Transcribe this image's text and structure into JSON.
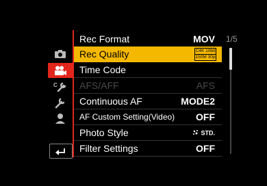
{
  "menu": {
    "items": [
      {
        "label": "Rec Format",
        "value": "MOV",
        "selected": false,
        "disabled": false
      },
      {
        "label": "Rec Quality",
        "value_badge_top": "C4K 10bit",
        "value_badge_bottom": "150M 30p",
        "selected": true,
        "disabled": false
      },
      {
        "label": "Time Code",
        "value": "",
        "selected": false,
        "disabled": false
      },
      {
        "label": "AFS/AFF",
        "value": "AFS",
        "selected": false,
        "disabled": true
      },
      {
        "label": "Continuous AF",
        "value": "MODE2",
        "selected": false,
        "disabled": false
      },
      {
        "label": "AF Custom Setting(Video)",
        "value": "OFF",
        "selected": false,
        "disabled": false
      },
      {
        "label": "Photo Style",
        "value": "STD.",
        "selected": false,
        "disabled": false
      },
      {
        "label": "Filter Settings",
        "value": "OFF",
        "selected": false,
        "disabled": false
      }
    ]
  },
  "page_indicator": "1/5",
  "sidebar": {
    "tabs": [
      {
        "name": "camera-icon",
        "active": false
      },
      {
        "name": "video-camera-icon",
        "active": true
      },
      {
        "name": "custom-wrench-icon",
        "active": false
      },
      {
        "name": "setup-wrench-icon",
        "active": false
      },
      {
        "name": "my-menu-person-icon",
        "active": false
      }
    ],
    "back": "return-arrow-icon"
  },
  "colors": {
    "selected": "#f5b800",
    "accent": "#e3261c"
  }
}
